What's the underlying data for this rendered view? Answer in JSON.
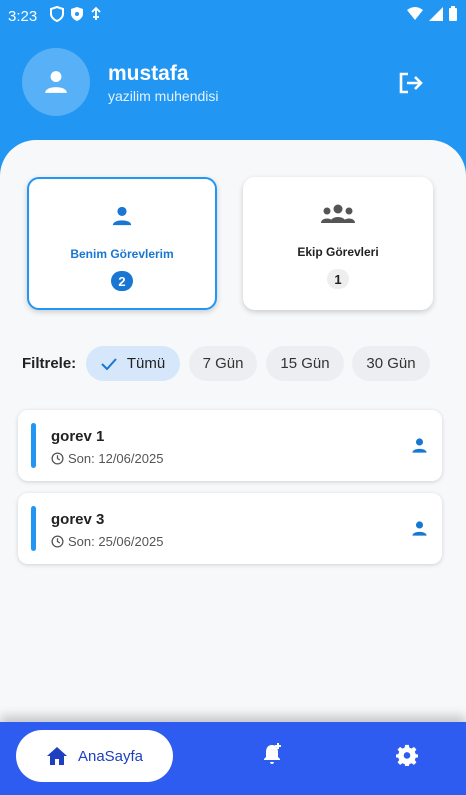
{
  "status_bar": {
    "time": "3:23"
  },
  "user": {
    "name": "mustafa",
    "role": "yazilim muhendisi"
  },
  "tabs": [
    {
      "label": "Benim Görevlerim",
      "count": "2",
      "selected": true
    },
    {
      "label": "Ekip Görevleri",
      "count": "1",
      "selected": false
    }
  ],
  "filters": {
    "label": "Filtrele:",
    "options": [
      "Tümü",
      "7 Gün",
      "15 Gün",
      "30 Gün"
    ],
    "selected": "Tümü"
  },
  "tasks": [
    {
      "title": "gorev 1",
      "due": "Son: 12/06/2025"
    },
    {
      "title": "gorev 3",
      "due": "Son: 25/06/2025"
    }
  ],
  "nav": {
    "home_label": "AnaSayfa"
  },
  "colors": {
    "primary": "#2196f3",
    "nav": "#2f5cf0",
    "accent": "#1976d2"
  },
  "icons": [
    "person-icon",
    "logout-icon",
    "group-icon",
    "check-icon",
    "clock-icon",
    "home-icon",
    "bell-add-icon",
    "gear-icon"
  ]
}
